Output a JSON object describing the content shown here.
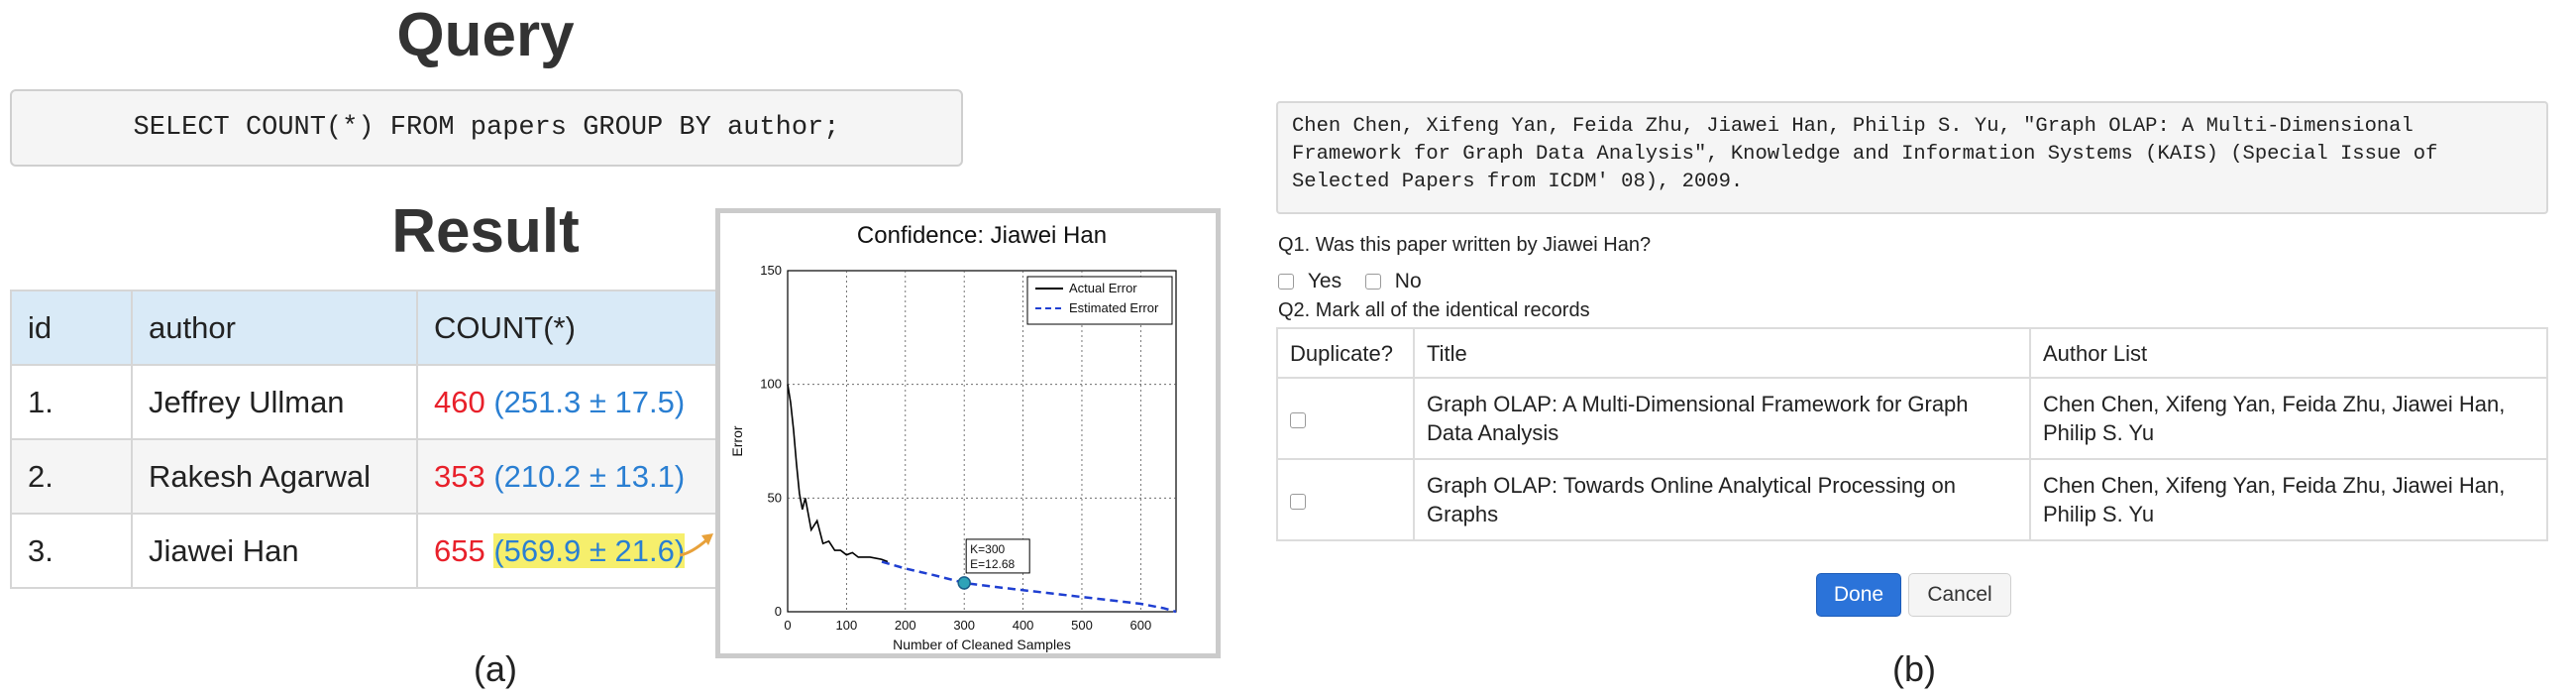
{
  "left_panel": {
    "query_heading": "Query",
    "query_sql": "SELECT COUNT(*) FROM papers GROUP BY author;",
    "result_heading": "Result",
    "table": {
      "headers": [
        "id",
        "author",
        "COUNT(*)"
      ],
      "rows": [
        {
          "id": "1.",
          "author": "Jeffrey Ullman",
          "count": "460",
          "estimate": "(251.3 ± 17.5)"
        },
        {
          "id": "2.",
          "author": "Rakesh Agarwal",
          "count": "353",
          "estimate": "(210.2 ± 13.1)"
        },
        {
          "id": "3.",
          "author": "Jiawei Han",
          "count": "655",
          "estimate": "(569.9 ± 21.6)"
        }
      ]
    },
    "caption": "(a)"
  },
  "confidence_chart": {
    "chart_data": {
      "type": "line",
      "title": "Confidence: Jiawei Han",
      "xlabel": "Number of Cleaned Samples",
      "ylabel": "Error",
      "xlim": [
        0,
        660
      ],
      "ylim": [
        0,
        150
      ],
      "xticks": [
        "0",
        "100",
        "200",
        "300",
        "400",
        "500",
        "600"
      ],
      "yticks": [
        "0",
        "50",
        "100",
        "150"
      ],
      "grid": true,
      "legend_position": "top-right",
      "series": [
        {
          "name": "Actual Error",
          "style": "solid",
          "color": "#000000",
          "x": [
            0,
            5,
            10,
            15,
            20,
            25,
            30,
            40,
            50,
            60,
            70,
            80,
            90,
            100,
            110,
            120,
            140,
            160,
            170
          ],
          "y": [
            100,
            92,
            80,
            65,
            52,
            45,
            50,
            36,
            40,
            30,
            31,
            27,
            27,
            25,
            26,
            24,
            24,
            23,
            22
          ]
        },
        {
          "name": "Estimated Error",
          "style": "dashed",
          "color": "#1f3fd1",
          "x": [
            160,
            200,
            250,
            300,
            350,
            400,
            450,
            500,
            550,
            600,
            640,
            660
          ],
          "y": [
            22,
            19,
            16,
            12.68,
            11,
            9.5,
            8,
            6.5,
            5,
            3.5,
            1.5,
            0
          ]
        }
      ],
      "annotation": {
        "x": 300,
        "y": 12.68,
        "lines": [
          "K=300",
          "E=12.68"
        ]
      }
    }
  },
  "right_panel": {
    "citation": "Chen Chen, Xifeng Yan, Feida Zhu, Jiawei Han, Philip S. Yu, \"Graph OLAP: A Multi-Dimensional Framework for Graph Data Analysis\", Knowledge and Information Systems (KAIS) (Special Issue of Selected Papers from ICDM' 08), 2009.",
    "q1": "Q1. Was this paper written by Jiawei Han?",
    "yes_label": "Yes",
    "no_label": "No",
    "q2": "Q2. Mark all of the identical records",
    "table": {
      "headers": [
        "Duplicate?",
        "Title",
        "Author List"
      ],
      "rows": [
        {
          "title": "Graph OLAP: A Multi-Dimensional Framework for Graph Data Analysis",
          "authors": "Chen Chen, Xifeng Yan, Feida Zhu, Jiawei Han, Philip S. Yu"
        },
        {
          "title": "Graph OLAP: Towards Online Analytical Processing on Graphs",
          "authors": "Chen Chen, Xifeng Yan, Feida Zhu, Jiawei Han, Philip S. Yu"
        }
      ]
    },
    "done_label": "Done",
    "cancel_label": "Cancel",
    "caption": "(b)"
  },
  "colors": {
    "count_red": "#e8202a",
    "estimate_blue": "#2a7fd2",
    "highlight_yellow": "#f6ef6c",
    "header_blue": "#d9eaf7",
    "done_button": "#2b73d9",
    "pointer_arrow": "#e8a13a"
  }
}
